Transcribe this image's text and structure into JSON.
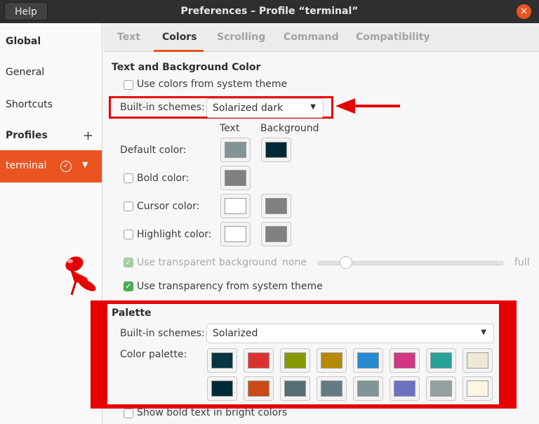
{
  "window": {
    "title": "Preferences – Profile “terminal”",
    "help_label": "Help",
    "close_glyph": "×"
  },
  "sidebar": {
    "global": "Global",
    "general": "General",
    "shortcuts": "Shortcuts",
    "profiles": "Profiles",
    "add_glyph": "+",
    "active_profile": "terminal"
  },
  "tabs": [
    "Text",
    "Colors",
    "Scrolling",
    "Command",
    "Compatibility"
  ],
  "active_tab": "Colors",
  "text_bg": {
    "title": "Text and Background Color",
    "use_system_theme": "Use colors from system theme",
    "builtin_label": "Built-in schemes:",
    "builtin_value": "Solarized dark",
    "col_text": "Text",
    "col_background": "Background",
    "default_color": "Default color:",
    "bold_color": "Bold color:",
    "cursor_color": "Cursor color:",
    "highlight_color": "Highlight color:",
    "use_transparent_bg": "Use transparent background",
    "slider_min": "none",
    "slider_max": "full",
    "use_transparency_system": "Use transparency from system theme"
  },
  "palette": {
    "title": "Palette",
    "builtin_label": "Built-in schemes:",
    "builtin_value": "Solarized",
    "color_palette_label": "Color palette:",
    "row1": [
      "#073642",
      "#dc322f",
      "#859900",
      "#b58900",
      "#268bd2",
      "#d33682",
      "#2aa198",
      "#eee8d5"
    ],
    "row2": [
      "#002b36",
      "#cb4b16",
      "#586e75",
      "#657b83",
      "#839496",
      "#6c71c4",
      "#93a1a1",
      "#fdf6e3"
    ],
    "show_bold_bright": "Show bold text in bright colors"
  },
  "colors": {
    "accent": "#e95420",
    "annotation_red": "#e60000",
    "default_text": "#839496",
    "default_bg": "#002b36",
    "bold": "#808080",
    "cursor_text": "#ffffff",
    "cursor_bg": "#808080",
    "highlight_text": "#ffffff",
    "highlight_bg": "#808080"
  }
}
